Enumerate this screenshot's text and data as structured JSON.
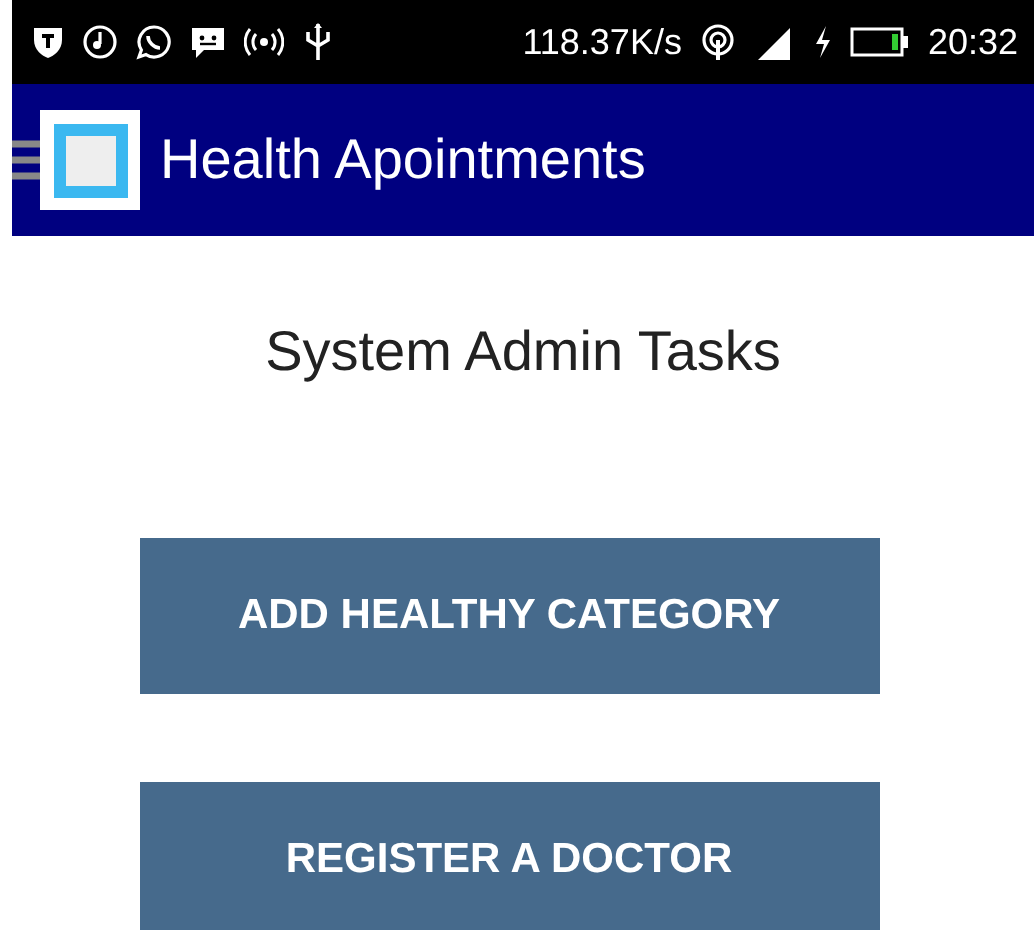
{
  "status_bar": {
    "speed": "118.37K/s",
    "time": "20:32"
  },
  "app_bar": {
    "title": "Health Apointments"
  },
  "heading": "System Admin Tasks",
  "buttons": [
    "ADD HEALTHY CATEGORY",
    "REGISTER A DOCTOR"
  ]
}
